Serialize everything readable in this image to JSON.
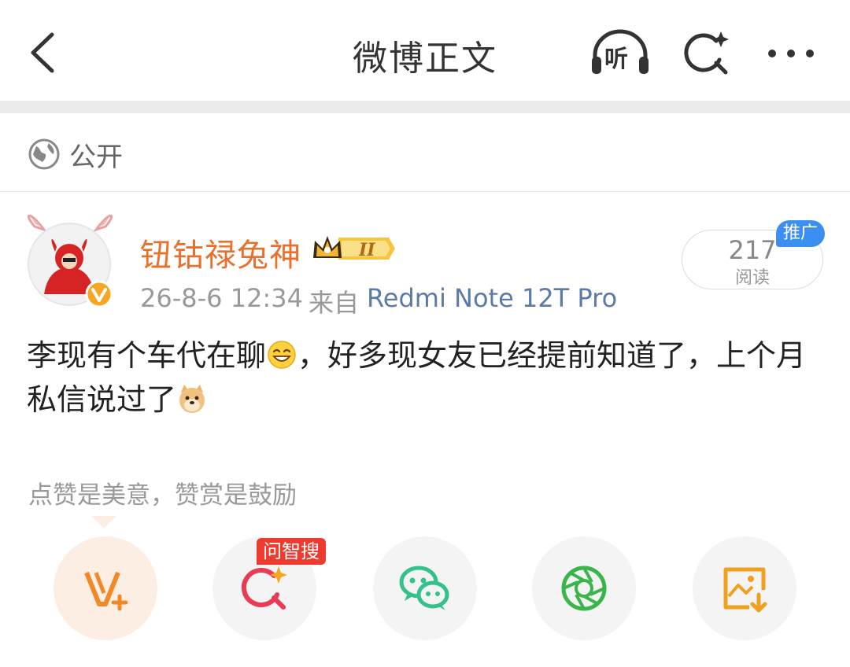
{
  "header": {
    "title": "微博正文",
    "listen_label": "听"
  },
  "visibility": {
    "label": "公开"
  },
  "post": {
    "username": "钮钴禄兔神",
    "time": "26-8-6 12:34",
    "from_label": "来自",
    "device": "Redmi Note 12T Pro",
    "read_count": "217",
    "read_label": "阅读",
    "promo_tag": "推广",
    "text_part1": "李现有个车代在聊",
    "text_part2": "，好多现女友已经提前知道了，上个月私信说过了",
    "emojis": [
      "grin-emoji",
      "doge-emoji"
    ]
  },
  "reward": {
    "encourage_text": "点赞是美意，赞赏是鼓励"
  },
  "actions": {
    "ask_badge": "问智搜",
    "items": [
      "v-plus",
      "ask-search",
      "wechat",
      "moments",
      "save-image"
    ]
  },
  "colors": {
    "username": "#e8702a",
    "link": "#5b7aa6",
    "promo": "#3b8ff0",
    "ask_badge": "#ee3a2f",
    "wechat": "#34c28a",
    "moments": "#3ab54a",
    "save": "#f0a020"
  }
}
